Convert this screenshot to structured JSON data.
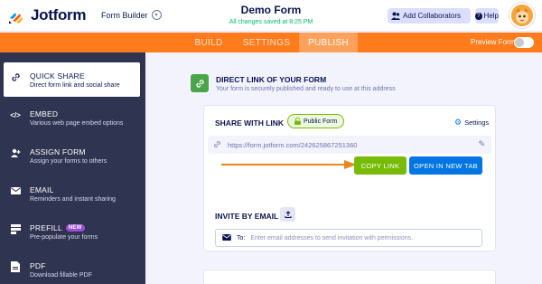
{
  "header": {
    "logo_text": "Jotform",
    "builder_menu": "Form Builder",
    "form_title": "Demo Form",
    "saved_status": "All changes saved at 8:25 PM",
    "collab_label": "Add Collaborators",
    "help_label": "Help"
  },
  "tabs": [
    {
      "label": "BUILD",
      "active": false
    },
    {
      "label": "SETTINGS",
      "active": false
    },
    {
      "label": "PUBLISH",
      "active": true
    }
  ],
  "preview": {
    "label": "Preview Form",
    "on": false
  },
  "sidebar": {
    "items": [
      {
        "title": "QUICK SHARE",
        "subtitle": "Direct form link and social share",
        "icon": "link-icon",
        "active": true
      },
      {
        "title": "EMBED",
        "subtitle": "Various web page embed options",
        "icon": "code-icon",
        "active": false
      },
      {
        "title": "ASSIGN FORM",
        "subtitle": "Assign your forms to others",
        "icon": "user-plus-icon",
        "active": false
      },
      {
        "title": "EMAIL",
        "subtitle": "Reminders and instant sharing",
        "icon": "mail-icon",
        "active": false
      },
      {
        "title": "PREFILL",
        "subtitle": "Pre-populate your forms",
        "icon": "prefill-icon",
        "badge": "NEW",
        "active": false
      },
      {
        "title": "PDF",
        "subtitle": "Download fillable PDF",
        "icon": "pdf-icon",
        "active": false
      }
    ]
  },
  "main": {
    "direct_link_title": "DIRECT LINK OF YOUR FORM",
    "direct_link_subtitle": "Your form is securely published and ready to use at this address",
    "share_label": "SHARE WITH LINK",
    "public_badge": "Public Form",
    "settings_label": "Settings",
    "form_url": "https://form.jotform.com/242625867251360",
    "copy_link_label": "COPY LINK",
    "open_tab_label": "OPEN IN NEW TAB",
    "invite_label": "INVITE BY EMAIL",
    "email_to_label": "To:",
    "email_placeholder": "Enter email addresses to send invitation with permissions."
  },
  "colors": {
    "accent_orange": "#ff7b1c",
    "copy_green": "#78bb07",
    "open_blue": "#0075e3",
    "sidebar_bg": "#2f3451",
    "arrow": "#e8891f"
  }
}
